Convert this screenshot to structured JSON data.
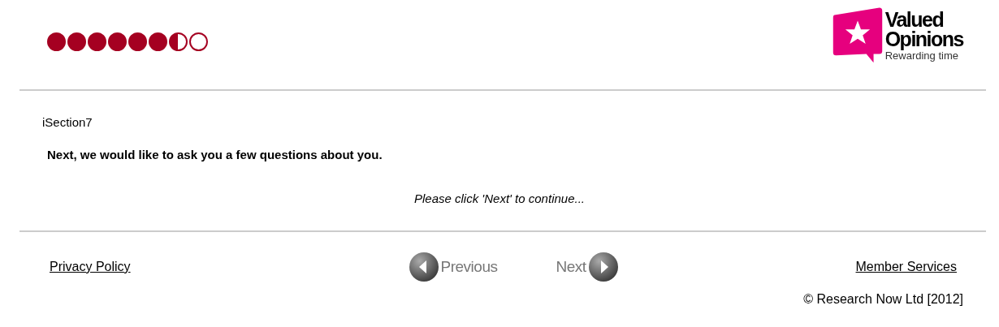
{
  "progress": [
    {
      "kind": "full"
    },
    {
      "kind": "full"
    },
    {
      "kind": "full"
    },
    {
      "kind": "full"
    },
    {
      "kind": "full"
    },
    {
      "kind": "full"
    },
    {
      "kind": "half"
    },
    {
      "kind": "empty"
    }
  ],
  "logo": {
    "line_1": "Valued",
    "line_2": "Opinions",
    "tagline": "Rewarding time"
  },
  "section": "iSection7",
  "question": "Next, we would like to ask you a few questions about you.",
  "instruction": "Please click 'Next' to continue...",
  "footer": {
    "privacy_link": "Privacy Policy",
    "previous_button": "Previous",
    "next_button": "Next",
    "member_link": "Member Services",
    "copyright": "© Research Now Ltd [2012]"
  }
}
